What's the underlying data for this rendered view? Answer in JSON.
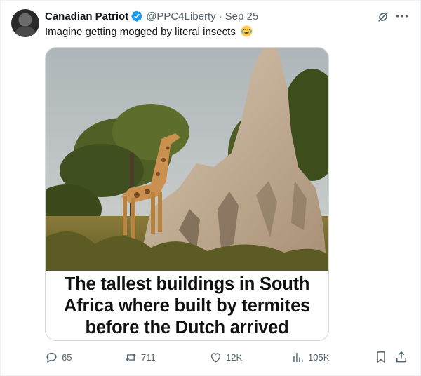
{
  "author": {
    "name": "Canadian Patriot",
    "handle": "@PPC4Liberty",
    "separator": "·",
    "date": "Sep 25"
  },
  "tweet": {
    "text": "Imagine getting mogged by literal insects",
    "emoji": "face-with-tears-of-joy"
  },
  "media": {
    "caption_lines": [
      "The tallest buildings in South",
      "Africa where built by termites",
      "before the Dutch arrived"
    ]
  },
  "actions": {
    "replies": "65",
    "reposts": "711",
    "likes": "12K",
    "views": "105K"
  },
  "colors": {
    "text": "#0f1419",
    "muted": "#536471",
    "verified": "#1d9bf0",
    "border": "#eff3f4"
  },
  "icons": [
    "verified-badge-icon",
    "grok-icon",
    "more-icon",
    "reply-icon",
    "repost-icon",
    "like-icon",
    "views-icon",
    "bookmark-icon",
    "share-icon"
  ]
}
